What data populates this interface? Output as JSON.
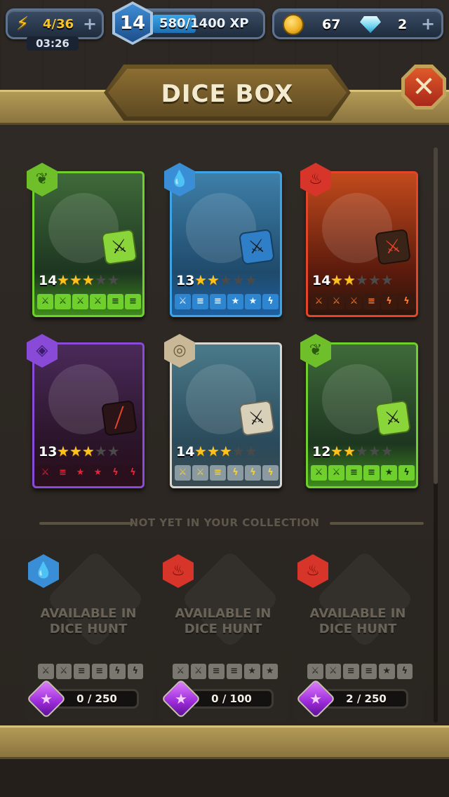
{
  "hud": {
    "energy": "4/36",
    "energy_timer": "03:26",
    "level": "14",
    "xp": "580/1400 XP",
    "xp_progress": 0.414,
    "gold": "67",
    "gems": "2"
  },
  "title": "DICE BOX",
  "owned_cards": [
    {
      "element": "nature",
      "level": "14",
      "stars": 3,
      "die_icon": "sword-icon",
      "faces": [
        "sword",
        "sword",
        "sword",
        "sword",
        "shield",
        "shield"
      ]
    },
    {
      "element": "water",
      "level": "13",
      "stars": 2,
      "die_icon": "sword-icon",
      "faces": [
        "sword",
        "shield",
        "shield",
        "star",
        "star",
        "bolt"
      ]
    },
    {
      "element": "fire",
      "level": "14",
      "stars": 2,
      "die_icon": "sword-icon",
      "faces": [
        "sword",
        "sword",
        "sword",
        "shield",
        "bolt",
        "bolt"
      ]
    },
    {
      "element": "dark",
      "level": "13",
      "stars": 3,
      "die_icon": "slash-icon",
      "faces": [
        "sword",
        "shield",
        "star",
        "star",
        "bolt",
        "bolt"
      ]
    },
    {
      "element": "earth",
      "level": "14",
      "stars": 3,
      "die_icon": "sword-icon",
      "faces": [
        "sword",
        "sword",
        "shield",
        "bolt",
        "bolt",
        "bolt"
      ]
    },
    {
      "element": "nature",
      "level": "12",
      "stars": 2,
      "die_icon": "sword-icon",
      "faces": [
        "sword",
        "sword",
        "shield",
        "shield",
        "star",
        "bolt"
      ]
    }
  ],
  "section_label": "NOT YET IN YOUR COLLECTION",
  "locked_cards": [
    {
      "element": "water",
      "availability": "AVAILABLE IN DICE HUNT",
      "progress": "0 / 250",
      "progress_fraction": 0,
      "faces": [
        "sword",
        "sword",
        "shield",
        "shield",
        "bolt",
        "bolt"
      ]
    },
    {
      "element": "fire",
      "availability": "AVAILABLE IN DICE HUNT",
      "progress": "0 / 100",
      "progress_fraction": 0,
      "faces": [
        "sword",
        "sword",
        "shield",
        "shield",
        "star",
        "star"
      ]
    },
    {
      "element": "fire",
      "availability": "AVAILABLE IN DICE HUNT",
      "progress": "2 / 250",
      "progress_fraction": 0.008,
      "faces": [
        "sword",
        "sword",
        "shield",
        "shield",
        "star",
        "bolt"
      ]
    }
  ]
}
